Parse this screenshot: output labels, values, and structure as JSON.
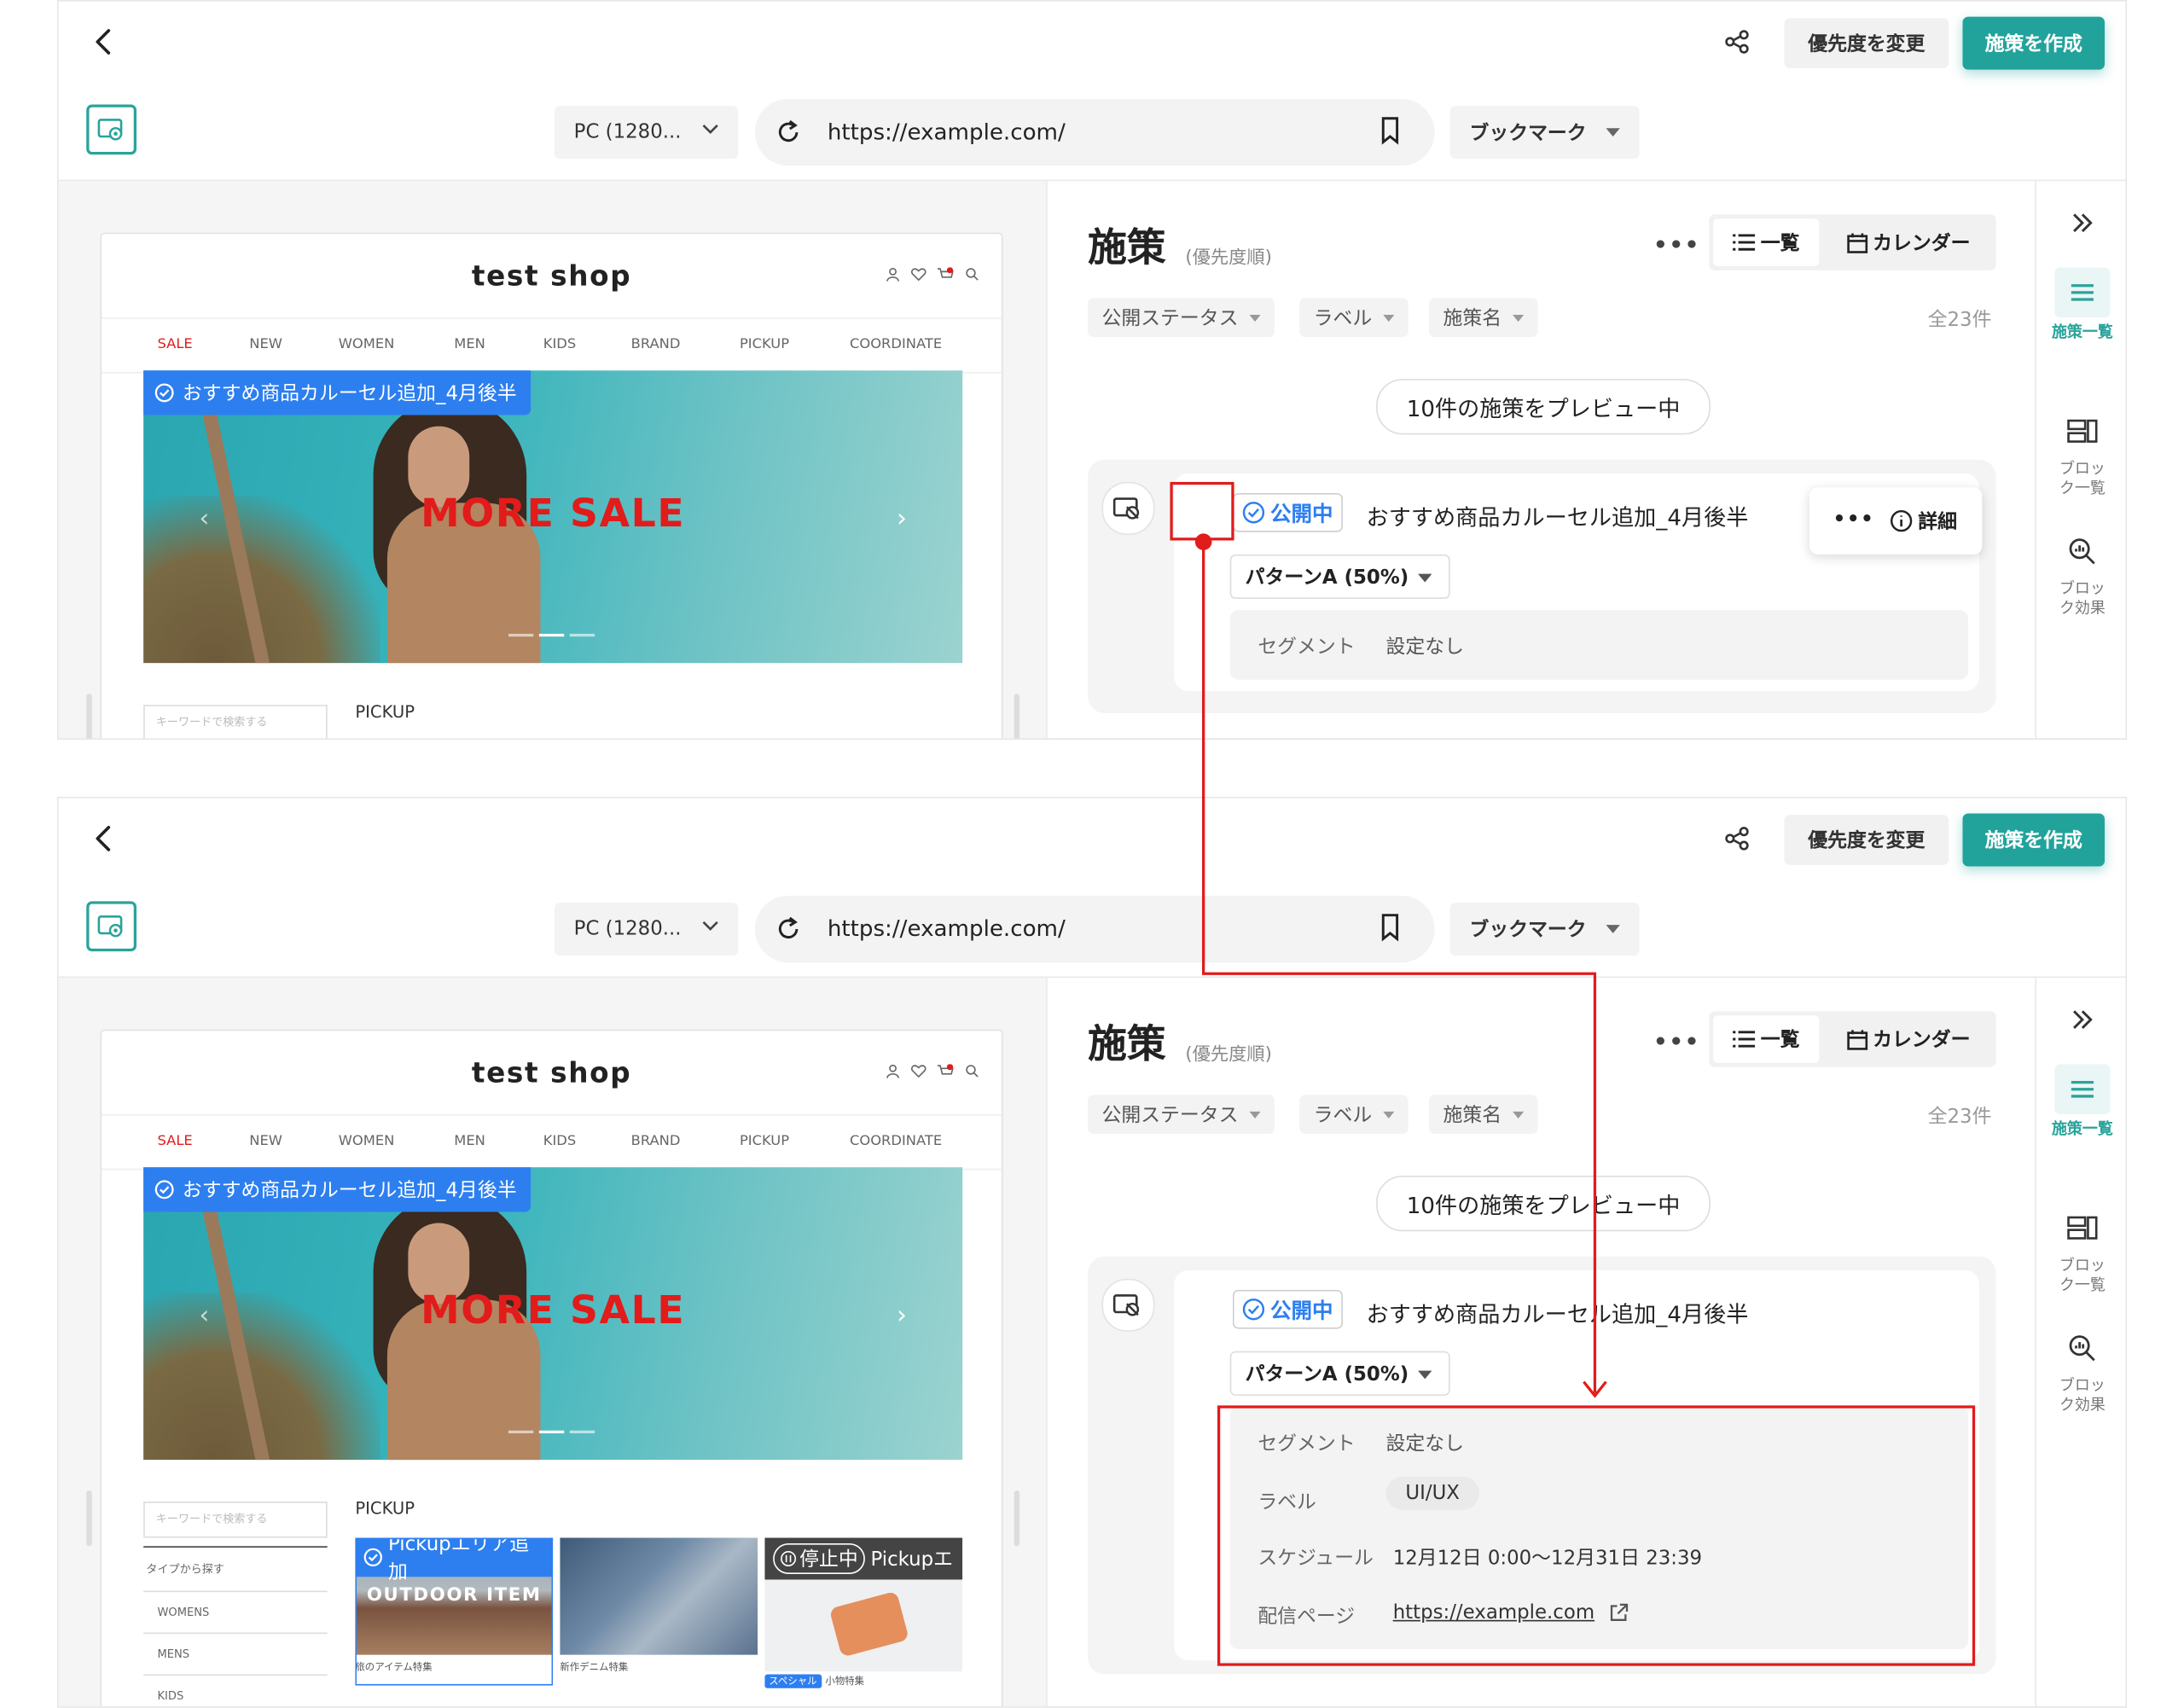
{
  "header": {
    "priority_button": "優先度を変更",
    "create_button": "施策を作成"
  },
  "toolbar": {
    "device": "PC (1280...",
    "url": "https://example.com/",
    "bookmark": "ブックマーク"
  },
  "site": {
    "title": "test shop",
    "nav": [
      "SALE",
      "NEW",
      "WOMEN",
      "MEN",
      "KIDS",
      "BRAND",
      "PICKUP",
      "COORDINATE"
    ],
    "campaign_tag": "おすすめ商品カルーセル追加_4月後半",
    "hero_text": "MORE SALE",
    "search_placeholder": "キーワードで検索する",
    "pickup_heading": "PICKUP",
    "sidebar_menu": [
      "タイプから探す",
      "WOMENS",
      "MENS",
      "KIDS"
    ],
    "pickup_items": [
      {
        "tag": "Pickupエリア追加",
        "image_text": "OUTDOOR ITEM",
        "caption": "旅のアイテム特集"
      },
      {
        "caption": "新作デニム特集"
      },
      {
        "tag_status": "停止中",
        "tag": "Pickupエ",
        "badge": "スペシャル",
        "caption": "小物特集"
      }
    ]
  },
  "campaigns": {
    "title": "施策",
    "subtitle": "(優先度順)",
    "view_list": "一覧",
    "view_calendar": "カレンダー",
    "filters": [
      "公開ステータス",
      "ラベル",
      "施策名"
    ],
    "count": "全23件",
    "preview_pill": "10件の施策をプレビュー中",
    "card": {
      "status": "公開中",
      "name": "おすすめ商品カルーセル追加_4月後半",
      "pattern": "パターンA (50%)",
      "detail_button": "詳細",
      "segment_label": "セグメント",
      "segment_value": "設定なし",
      "label_label": "ラベル",
      "label_value": "UI/UX",
      "schedule_label": "スケジュール",
      "schedule_value": "12月12日 0:00〜12月31日 23:39",
      "page_label": "配信ページ",
      "page_value": "https://example.com"
    }
  },
  "rail": {
    "list": "施策一覧",
    "block_list": "ブロック一覧",
    "block_effect": "ブロック効果"
  },
  "colors": {
    "accent": "#21a39b",
    "status_blue": "#2d7ff0",
    "annotation_red": "#e21b1b"
  }
}
